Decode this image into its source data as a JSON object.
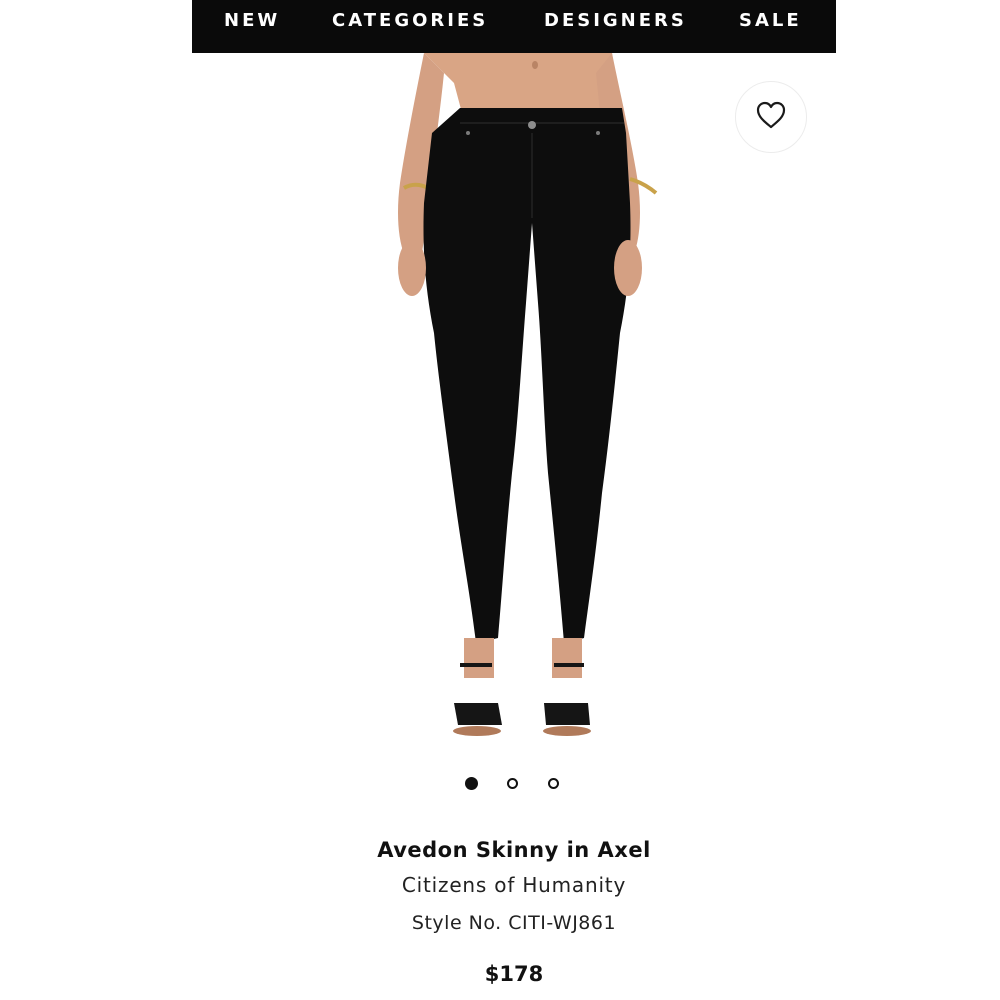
{
  "nav": {
    "items": [
      {
        "label": "NEW"
      },
      {
        "label": "CATEGORIES"
      },
      {
        "label": "DESIGNERS"
      },
      {
        "label": "SALE"
      }
    ]
  },
  "product": {
    "name": "Avedon Skinny in Axel",
    "designer": "Citizens of Humanity",
    "style_no": "Style No. CITI-WJ861",
    "price": "$178"
  },
  "carousel": {
    "total": 3,
    "active_index": 0
  },
  "icons": {
    "wishlist": "heart-icon"
  },
  "colors": {
    "nav_background": "#0a0a0a",
    "nav_text": "#ffffff",
    "text": "#111111",
    "jeans": "#0d0d0d"
  }
}
